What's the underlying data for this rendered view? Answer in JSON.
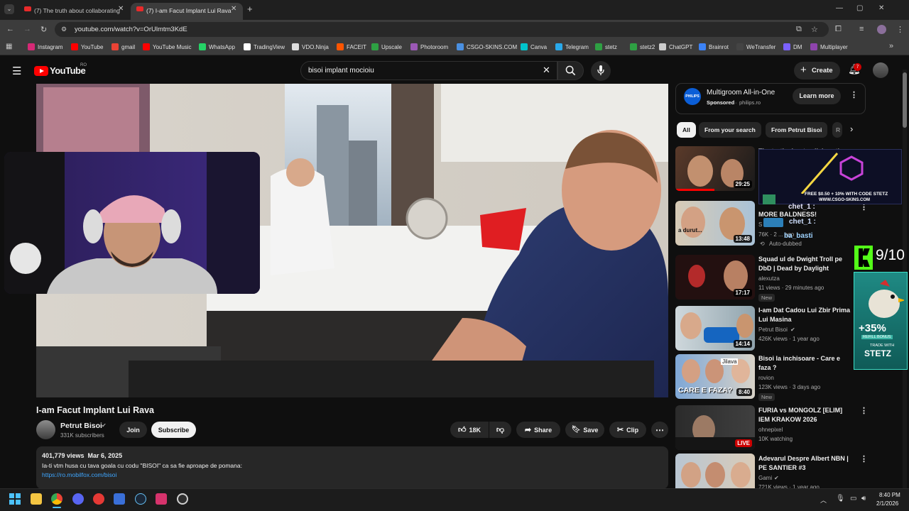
{
  "browser": {
    "tabs": [
      {
        "label": "(7) The truth about collaborating"
      },
      {
        "label": "(7) I-am Facut Implant Lui Rava"
      }
    ],
    "url": "youtube.com/watch?v=OrUlmtm3KdE",
    "bookmarks": [
      "Instagram",
      "YouTube",
      "gmail",
      "YouTube Music",
      "WhatsApp",
      "TradingView",
      "VDO.Ninja",
      "FACEIT",
      "Upscale",
      "Photoroom",
      "CSGO-SKINS.COM",
      "Canva",
      "Telegram",
      "stetz",
      "stetz2",
      "ChatGPT",
      "Brainrot",
      "WeTransfer",
      "DM",
      "Multiplayer"
    ]
  },
  "youtube": {
    "logo": "YouTube",
    "region": "RO",
    "search_value": "bisoi implant mocioiu",
    "create_label": "Create",
    "notif_count": "7"
  },
  "video": {
    "title": "I-am Facut Implant Lui Rava",
    "channel": "Petrut Bisoi",
    "subscribers": "331K subscribers",
    "join_label": "Join",
    "subscribe_label": "Subscribe",
    "likes": "18K",
    "share_label": "Share",
    "save_label": "Save",
    "clip_label": "Clip",
    "views_date": "401,779 views  Mar 6, 2025",
    "desc_line": "Ia-ti vtm husa cu tava goala cu codu \"BISOI\" ca sa fie aproape de pomana:",
    "desc_link": "https://ro.mobilfox.com/bisoi"
  },
  "ad": {
    "title": "Multigroom All-in-One",
    "sponsored": "Sponsored",
    "domain": "philips.ro",
    "cta": "Learn more",
    "brand": "PHILIPS"
  },
  "chips": [
    "All",
    "From your search",
    "From Petrut Bisoi",
    "R"
  ],
  "recommended": [
    {
      "title": "The truth about collaborating",
      "channel": "",
      "meta": "",
      "duration": "29:25",
      "badge": ""
    },
    {
      "title": "MORE BALDNESS!",
      "channel": "S",
      "meta": "76K · 2 ... ago",
      "duration": "13:48",
      "badge": "Auto-dubbed"
    },
    {
      "title": "Squad ul de Dwight Troll pe DbD | Dead by Daylight",
      "channel": "alexutza",
      "meta": "11 views · 29 minutes ago",
      "duration": "17:17",
      "badge": "New"
    },
    {
      "title": "I-am Dat Cadou Lui Zbir Prima Lui Masina",
      "channel": "Petrut Bisoi",
      "meta": "426K views · 1 year ago",
      "duration": "14:14",
      "badge": ""
    },
    {
      "title": "Bisoi la inchisoare - Care e faza ?",
      "channel": "rovion",
      "meta": "123K views · 3 days ago",
      "duration": "8:40",
      "badge": "New"
    },
    {
      "title": "FURIA vs MONGOLZ [ELIM] IEM KRAKOW 2026",
      "channel": "ohnepixel",
      "meta": "10K watching",
      "duration": "LIVE",
      "badge": ""
    },
    {
      "title": "Adevarul Despre Albert NBN | PE SANTIER #3",
      "channel": "Gami",
      "meta": "721K views · 1 year ago",
      "duration": "",
      "badge": ""
    }
  ],
  "overlay": {
    "chat_names": [
      "chet_1 :",
      "ba_basti"
    ],
    "promo": "FREE $0.50 + 10% WITH CODE STETZ",
    "promo_site": "WWW.CSGO-SKINS.COM",
    "score": "9/10",
    "refill": "+35%",
    "refill_sub": "REFILL BONUS",
    "trade_with": "TRADE WITH",
    "trade_code": "STETZ"
  },
  "thumb_texts": {
    "durut": "a durut...",
    "care": "CARE E FAZA?",
    "jilava": "Jilava"
  },
  "taskbar": {
    "time": "8:40 PM",
    "date": "2/1/2026"
  }
}
